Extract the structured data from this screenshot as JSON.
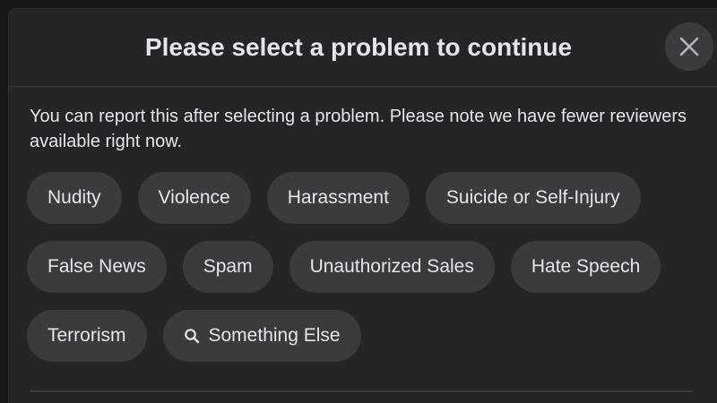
{
  "dialog": {
    "title": "Please select a problem to continue",
    "close_icon": "close-icon",
    "description": "You can report this after selecting a problem. Please note we have fewer reviewers available right now."
  },
  "problems": {
    "row1": [
      "Nudity",
      "Violence",
      "Harassment",
      "Suicide or Self-Injury"
    ],
    "row2": [
      "False News",
      "Spam",
      "Unauthorized Sales",
      "Hate Speech"
    ],
    "row3": [
      "Terrorism",
      "Something Else"
    ],
    "something_else_icon": "search-icon"
  },
  "colors": {
    "background": "#18191a",
    "surface": "#242526",
    "chip": "#3a3b3c",
    "text": "#e4e6eb"
  }
}
